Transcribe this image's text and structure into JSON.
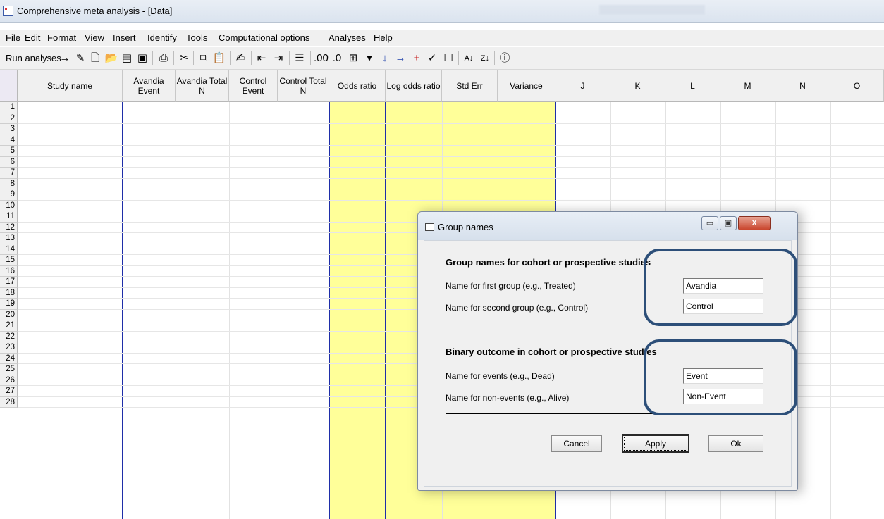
{
  "window": {
    "title": "Comprehensive meta analysis - [Data]"
  },
  "menu": [
    "File",
    "Edit",
    "Format",
    "View",
    "Insert",
    "Identify",
    "Tools",
    "Computational options",
    "Analyses",
    "Help"
  ],
  "toolbar": {
    "run_label": "Run analyses",
    "icons": [
      "arrow-right-icon",
      "wand-icon",
      "new-file-icon",
      "open-folder-icon",
      "open-data-icon",
      "save-icon",
      "print-icon",
      "cut-icon",
      "copy-icon",
      "paste-icon",
      "edit-icon",
      "decrease-indent-icon",
      "increase-indent-icon",
      "outline-icon",
      "decimals-increase-icon",
      "decimals-decrease-icon",
      "column-format-icon",
      "dropdown-icon",
      "move-down-icon",
      "move-right-icon",
      "add-icon",
      "check-icon",
      "checkbox-icon",
      "sort-ascending-icon",
      "sort-descending-icon",
      "info-icon"
    ]
  },
  "grid": {
    "columns": [
      {
        "label": "Study name"
      },
      {
        "label": "Avandia Event"
      },
      {
        "label": "Avandia Total N"
      },
      {
        "label": "Control Event"
      },
      {
        "label": "Control Total N"
      },
      {
        "label": "Odds ratio"
      },
      {
        "label": "Log odds ratio"
      },
      {
        "label": "Std Err"
      },
      {
        "label": "Variance"
      },
      {
        "label": "J"
      },
      {
        "label": "K"
      },
      {
        "label": "L"
      },
      {
        "label": "M"
      },
      {
        "label": "N"
      },
      {
        "label": "O"
      }
    ],
    "rows": [
      "1",
      "2",
      "3",
      "4",
      "5",
      "6",
      "7",
      "8",
      "9",
      "10",
      "11",
      "12",
      "13",
      "14",
      "15",
      "16",
      "17",
      "18",
      "19",
      "20",
      "21",
      "22",
      "23",
      "24",
      "25",
      "26",
      "27",
      "28"
    ],
    "computed_color": "#ffff99"
  },
  "dialog": {
    "title": "Group names",
    "section1_title": "Group names for cohort or prospective studies",
    "first_group_label": "Name for first group (e.g., Treated)",
    "first_group_value": "Avandia",
    "second_group_label": "Name for second group (e.g., Control)",
    "second_group_value": "Control",
    "section2_title": "Binary outcome in cohort or prospective studies",
    "events_label": "Name for events (e.g., Dead)",
    "events_value": "Event",
    "nonevents_label": "Name for non-events (e.g., Alive)",
    "nonevents_value": "Non-Event",
    "cancel_label": "Cancel",
    "apply_label": "Apply",
    "ok_label": "Ok",
    "minimize_symbol": "▭",
    "maximize_symbol": "▣",
    "close_symbol": "X"
  },
  "highlight_color": "#2d4f79"
}
